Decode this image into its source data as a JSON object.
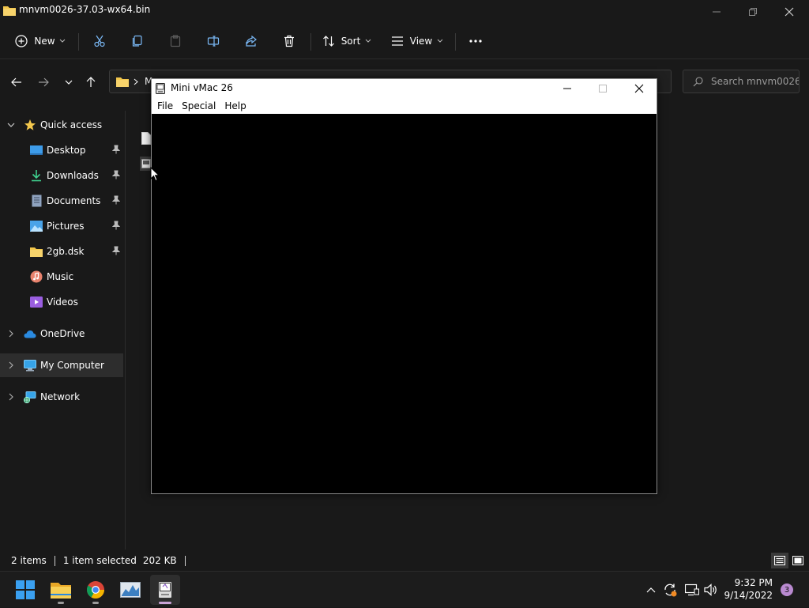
{
  "window": {
    "title": "mnvm0026-37.03-wx64.bin"
  },
  "toolbar": {
    "new_label": "New",
    "sort_label": "Sort",
    "view_label": "View"
  },
  "address": {
    "path_partial": "M"
  },
  "search": {
    "placeholder": "Search mnvm0026..."
  },
  "sidebar": {
    "quick_access": "Quick access",
    "items": [
      {
        "label": "Desktop",
        "icon": "desktop-icon",
        "pinned": true
      },
      {
        "label": "Downloads",
        "icon": "download-icon",
        "pinned": true
      },
      {
        "label": "Documents",
        "icon": "document-icon",
        "pinned": true
      },
      {
        "label": "Pictures",
        "icon": "pictures-icon",
        "pinned": true
      },
      {
        "label": "2gb.dsk",
        "icon": "folder-icon",
        "pinned": true
      },
      {
        "label": "Music",
        "icon": "music-icon",
        "pinned": false
      },
      {
        "label": "Videos",
        "icon": "videos-icon",
        "pinned": false
      }
    ],
    "onedrive": "OneDrive",
    "my_computer": "My Computer",
    "network": "Network"
  },
  "status": {
    "items": "2 items",
    "selected": "1 item selected",
    "size": "202 KB"
  },
  "vmac": {
    "title": "Mini vMac 26",
    "menus": [
      "File",
      "Special",
      "Help"
    ]
  },
  "clock": {
    "time": "9:32 PM",
    "date": "9/14/2022"
  },
  "notifications": {
    "count": "3"
  },
  "colors": {
    "accent": "#c9a3d6",
    "folder": "#f3c74c",
    "background": "#191919"
  }
}
